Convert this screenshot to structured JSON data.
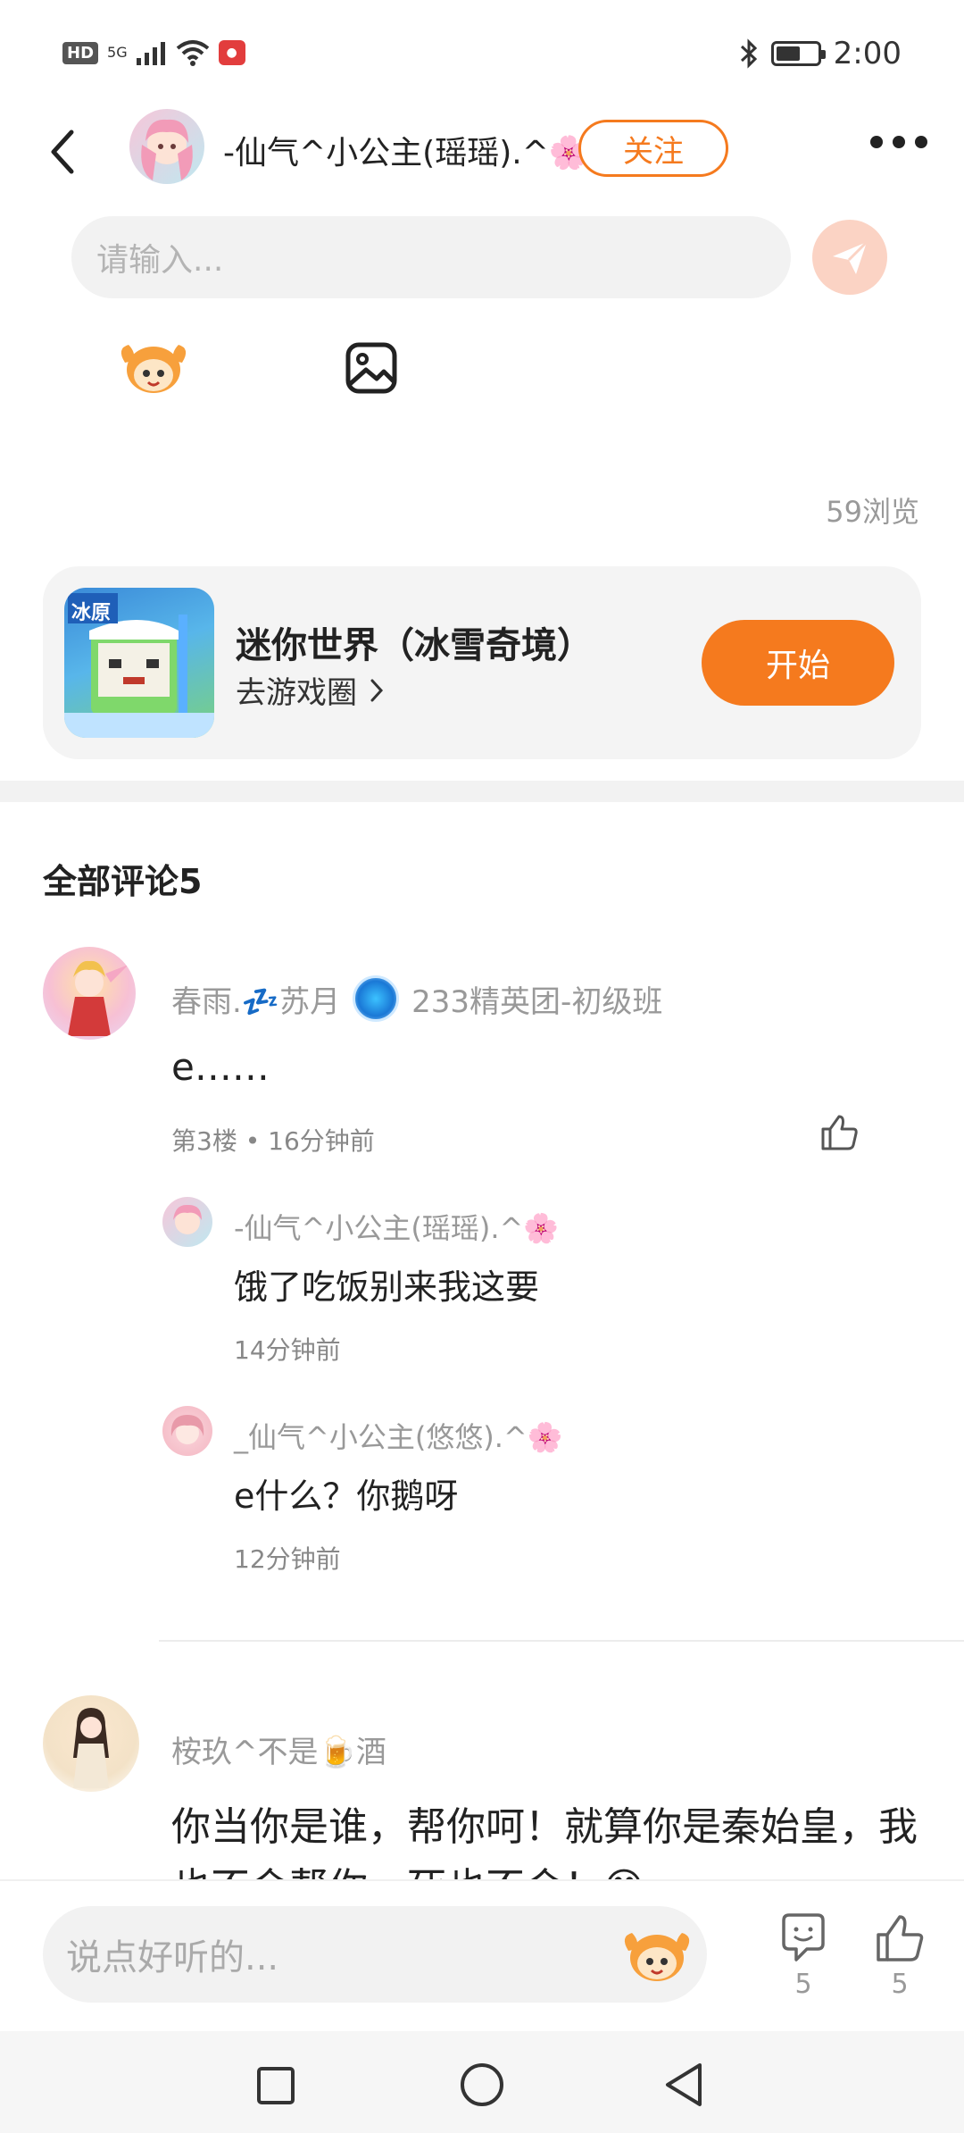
{
  "status_bar": {
    "hd_label": "HD",
    "network": "5G",
    "time": "2:00",
    "battery_level": 0.6
  },
  "header": {
    "title": "-仙气^小公主(瑶瑶).^🌸",
    "follow_label": "关注"
  },
  "reply_box": {
    "placeholder": "请输入..."
  },
  "post": {
    "views": "59浏览"
  },
  "game_card": {
    "title": "迷你世界（冰雪奇境）",
    "link_label": "去游戏圈",
    "icon_tag": "冰原",
    "start_label": "开始"
  },
  "comments": {
    "heading": "全部评论5",
    "items": [
      {
        "author": "春雨.💤苏月",
        "badge": "233精英团-初级班",
        "text": "e……",
        "meta": "第3楼 • 16分钟前",
        "replies": [
          {
            "author": "-仙气^小公主(瑶瑶).^🌸",
            "text": "饿了吃饭别来我这要",
            "time": "14分钟前"
          },
          {
            "author": "_仙气^小公主(悠悠).^🌸",
            "text": "e什么？你鹅呀",
            "time": "12分钟前"
          }
        ]
      },
      {
        "author": "桉玖^不是🍺酒",
        "text": "你当你是谁，帮你呵！就算你是秦始皇，我也不会帮你，死也不会！😊"
      }
    ]
  },
  "bottom_bar": {
    "placeholder": "说点好听的...",
    "comment_count": "5",
    "like_count": "5"
  },
  "colors": {
    "accent": "#f57a1e",
    "muted_text": "#999999",
    "divider": "#f2f2f2"
  }
}
